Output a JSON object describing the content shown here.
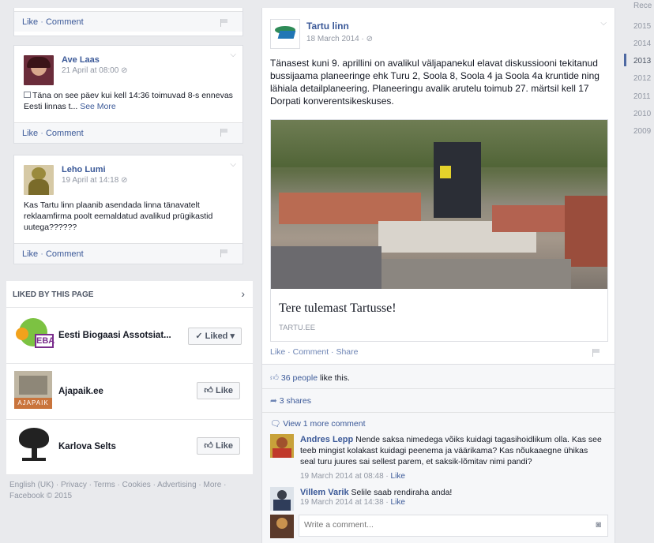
{
  "left": {
    "top_bar": {
      "like": "Like",
      "comment": "Comment"
    },
    "post1": {
      "author": "Ave Laas",
      "time": "21 April at 08:00",
      "text": "Täna on see päev kui kell 14:36 toimuvad 8-s ennevas Eesti linnas t...",
      "see_more": "See More",
      "like": "Like",
      "comment": "Comment"
    },
    "post2": {
      "author": "Leho Lumi",
      "time": "19 April at 14:18",
      "text": "Kas Tartu linn plaanib asendada linna tänavatelt reklaamfirma poolt eemaldatud avalikud prügikastid uutega??????",
      "like": "Like",
      "comment": "Comment"
    },
    "liked": {
      "header": "LIKED BY THIS PAGE",
      "items": [
        {
          "name": "Eesti Biogaasi Assotsiat...",
          "button": "Liked"
        },
        {
          "name": "Ajapaik.ee",
          "button": "Like",
          "logo_text": "AJAPAIK"
        },
        {
          "name": "Karlova Selts",
          "button": "Like"
        }
      ]
    },
    "footer": {
      "links": [
        "English (UK)",
        "Privacy",
        "Terms",
        "Cookies",
        "Advertising",
        "More"
      ],
      "copyright": "Facebook © 2015"
    }
  },
  "main": {
    "page_name": "Tartu linn",
    "time": "18 March 2014",
    "post_text": "Tänasest kuni 9. aprillini on avalikul väljapanekul elavat diskussiooni tekitanud bussijaama planeeringe ehk Turu 2, Soola 8, Soola 4 ja Soola 4a kruntide ning lähiala detailplaneering. Planeeringu avalik arutelu toimub 27. märtsil kell 17 Dorpati konverentsikeskuses.",
    "link_title": "Tere tulemast Tartusse!",
    "link_domain": "TARTU.EE",
    "actions": {
      "like": "Like",
      "comment": "Comment",
      "share": "Share"
    },
    "likes_count": "36 people",
    "likes_suffix": " like this.",
    "shares": "3 shares",
    "view_more": "View 1 more comment",
    "comments": [
      {
        "author": "Andres Lepp",
        "text": "Nende saksa nimedega võiks kuidagi tagasihoidlikum olla. Kas see teeb mingist kolakast kuidagi peenema ja väärikama? Kas nõukaaegne ühikas seal turu juures sai sellest parem, et saksik-lõmitav nimi pandi?",
        "time": "19 March 2014 at 08:48",
        "like": "Like"
      },
      {
        "author": "Villem Varik",
        "text": "Selile saab rendiraha anda!",
        "time": "19 March 2014 at 14:38",
        "like": "Like"
      }
    ],
    "write_placeholder": "Write a comment..."
  },
  "timeline": {
    "top_label": "Rece",
    "years": [
      "2015",
      "2014",
      "2013",
      "2012",
      "2011",
      "2010",
      "2009"
    ],
    "active": "2013"
  },
  "colors": {
    "link": "#3b5998",
    "bg": "#e9eaed",
    "accent": "#4e69a2"
  }
}
